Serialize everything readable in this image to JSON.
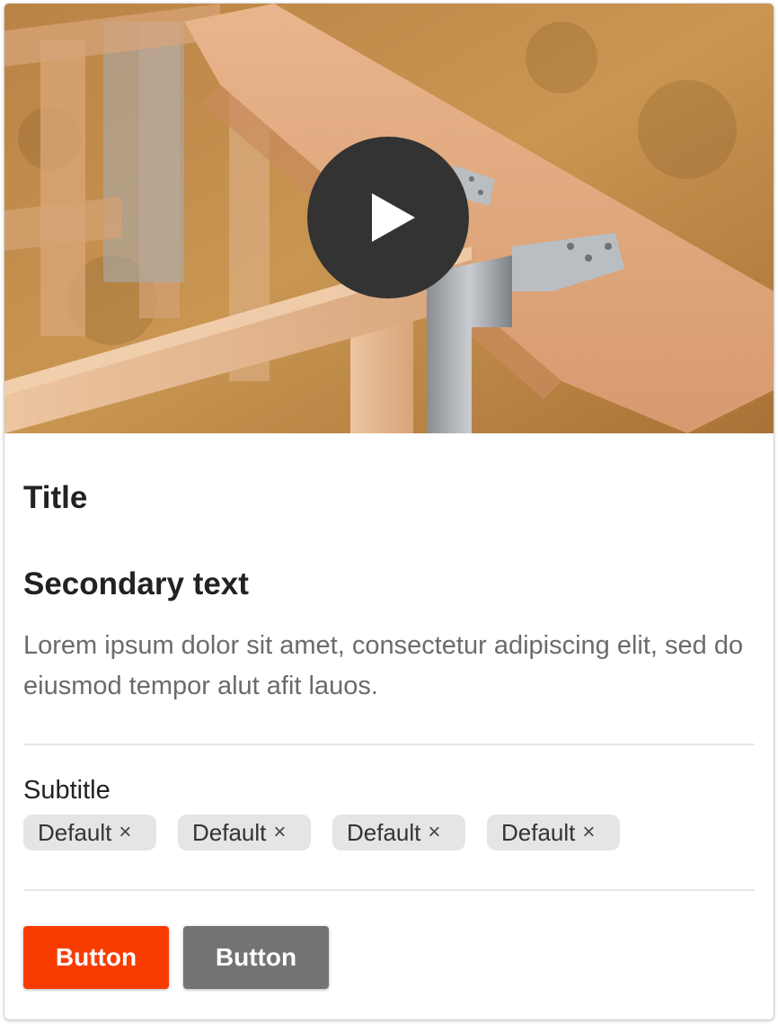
{
  "media": {
    "play_icon": "play-icon",
    "play_button_color": "#333333"
  },
  "card": {
    "title": "Title",
    "secondary_text": "Secondary text",
    "body": "Lorem ipsum dolor sit amet, consectetur adipiscing elit, sed do eiusmod tempor alut afit lauos.",
    "subtitle": "Subtitle"
  },
  "chips": [
    {
      "label": "Default",
      "remove_icon": "×"
    },
    {
      "label": "Default",
      "remove_icon": "×"
    },
    {
      "label": "Default",
      "remove_icon": "×"
    },
    {
      "label": "Default",
      "remove_icon": "×"
    }
  ],
  "buttons": {
    "primary_label": "Button",
    "primary_color": "#f83c00",
    "secondary_label": "Button",
    "secondary_color": "#737373"
  }
}
